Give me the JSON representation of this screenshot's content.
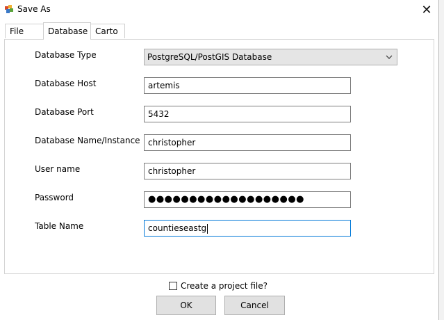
{
  "window": {
    "title": "Save As",
    "close_glyph": "✕"
  },
  "tabs": [
    {
      "label": "File",
      "active": false
    },
    {
      "label": "Database",
      "active": true
    },
    {
      "label": "Carto",
      "active": false
    }
  ],
  "form": {
    "database_type": {
      "label": "Database Type",
      "value": "PostgreSQL/PostGIS Database"
    },
    "database_host": {
      "label": "Database Host",
      "value": "artemis"
    },
    "database_port": {
      "label": "Database Port",
      "value": "5432"
    },
    "database_name": {
      "label": "Database Name/Instance",
      "value": "christopher"
    },
    "user_name": {
      "label": "User name",
      "value": "christopher"
    },
    "password": {
      "label": "Password",
      "masked_value": "●●●●●●●●●●●●●●●●●●●"
    },
    "table_name": {
      "label": "Table Name",
      "value": "countieseastg"
    }
  },
  "create_project": {
    "label": "Create a project file?",
    "checked": false
  },
  "buttons": {
    "ok": "OK",
    "cancel": "Cancel"
  },
  "icons": {
    "app": "app-icon",
    "close": "close-icon",
    "chevron": "chevron-down-icon"
  }
}
